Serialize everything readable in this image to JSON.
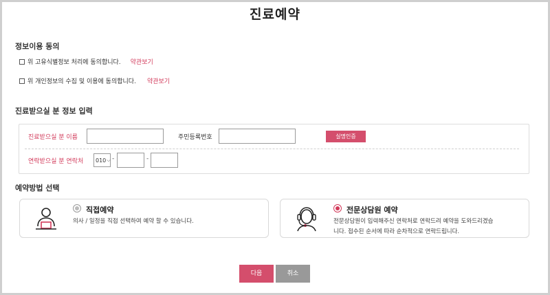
{
  "page": {
    "title": "진료예약"
  },
  "consent": {
    "heading": "정보이용 동의",
    "items": [
      {
        "text": "위 고유식별정보 처리에 동의합니다.",
        "link": "약관보기"
      },
      {
        "text": "위 개인정보의 수집 및 이용에 동의합니다.",
        "link": "약관보기"
      }
    ]
  },
  "patient_info": {
    "heading": "진료받으실 분 정보 입력",
    "name_label": "진료받으실 분 이름",
    "id_label": "주민등록번호",
    "verify_button": "실명인증",
    "contact_label": "연락받으실 분 연락처",
    "phone_prefix": "010",
    "phone_separator": "-"
  },
  "method": {
    "heading": "예약방법 선택",
    "options": [
      {
        "title": "직접예약",
        "desc_lines": [
          "의사 / 일정을 직접 선택하여 예약 할 수 있습니다."
        ],
        "selected": false,
        "icon": "person-laptop-icon"
      },
      {
        "title": "전문상담원 예약",
        "desc_lines": [
          "전문상담원이 입력해주신 연락처로 연락드려 예약을 도와드리겠습",
          "니다. 접수된 순서에 따라 순차적으로 연락드립니다."
        ],
        "selected": true,
        "icon": "headset-agent-icon"
      }
    ]
  },
  "actions": {
    "next": "다음",
    "cancel": "취소"
  },
  "colors": {
    "accent": "#d44e6c",
    "link": "#d2395a",
    "cancel_button": "#999999"
  }
}
